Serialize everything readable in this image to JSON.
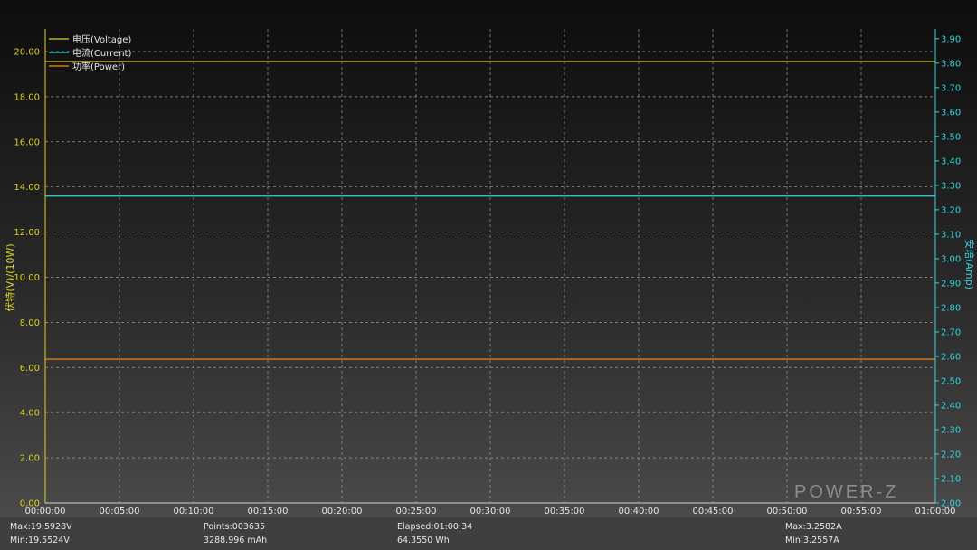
{
  "chart_data": {
    "type": "line",
    "left_axis": {
      "label": "伏特(V)/(10W)",
      "color": "#d8d02a",
      "ylim": [
        0,
        21
      ],
      "ticks": [
        "0.00",
        "2.00",
        "4.00",
        "6.00",
        "8.00",
        "10.00",
        "12.00",
        "14.00",
        "16.00",
        "18.00",
        "20.00"
      ]
    },
    "right_axis": {
      "label": "安培(Amp)",
      "color": "#33d6dc",
      "ylim": [
        2.0,
        3.94
      ],
      "ticks": [
        "2.00",
        "2.10",
        "2.20",
        "2.30",
        "2.40",
        "2.50",
        "2.60",
        "2.70",
        "2.80",
        "2.90",
        "3.00",
        "3.10",
        "3.20",
        "3.30",
        "3.40",
        "3.50",
        "3.60",
        "3.70",
        "3.80",
        "3.90"
      ]
    },
    "x_axis": {
      "ticks": [
        "00:00:00",
        "00:05:00",
        "00:10:00",
        "00:15:00",
        "00:20:00",
        "00:25:00",
        "00:30:00",
        "00:35:00",
        "00:40:00",
        "00:45:00",
        "00:50:00",
        "00:55:00",
        "01:00:00"
      ],
      "xlim_minutes": [
        0,
        60
      ]
    },
    "grid": true,
    "legend_position": "top-left",
    "series": [
      {
        "name": "电压(Voltage)",
        "axis": "left",
        "color": "#d8d02a",
        "x_minutes": [
          0,
          60
        ],
        "values": [
          19.56,
          19.56
        ]
      },
      {
        "name": "电流(Current)",
        "axis": "right",
        "color": "#33d6dc",
        "x_minutes": [
          0,
          60
        ],
        "values": [
          3.256,
          3.256
        ]
      },
      {
        "name": "功率(Power)",
        "axis": "left",
        "color": "#ff8a1f",
        "x_minutes": [
          0,
          60
        ],
        "values": [
          6.37,
          6.37
        ]
      }
    ],
    "watermark": "POWER-Z"
  },
  "footer": {
    "max_v": "Max:19.5928V",
    "min_v": "Min:19.5524V",
    "points": "Points:003635",
    "mah": "3288.996 mAh",
    "elapsed": "Elapsed:01:00:34",
    "wh": "64.3550 Wh",
    "max_a": "Max:3.2582A",
    "min_a": "Min:3.2557A"
  }
}
